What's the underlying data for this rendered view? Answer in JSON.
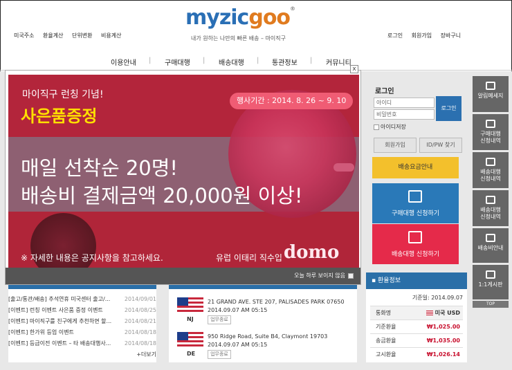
{
  "header": {
    "logo_part1": "myzic",
    "logo_part2": "goo",
    "logo_reg": "®",
    "tagline": "내가 원하는 나만의 빠른 배송 – 마이직구",
    "left_links": [
      "미국주소",
      "환율계산",
      "단위변환",
      "비용계산"
    ],
    "right_links": [
      "로그인",
      "회원가입",
      "장바구니"
    ]
  },
  "nav": {
    "items": [
      "이용안내",
      "구매대행",
      "배송대행",
      "통관정보",
      "커뮤니티"
    ]
  },
  "popup": {
    "close": "x",
    "line1": "마이직구 런칭 기념!",
    "line2": "사은품증정",
    "period": "행사기간 : 2014. 8. 26 ~ 9. 10",
    "big1": "매일 선착순 20명!",
    "big2": "배송비 결제금액 20,000원 이상!",
    "note": "※ 자세한 내용은 공지사항을 참고하세요.",
    "brand_text": "유럽 이태리 직수입",
    "brand_logo": "domo",
    "footer_text": "오늘 하루 보이지 않음"
  },
  "login": {
    "title": "로그인",
    "id_placeholder": "아이디",
    "pw_placeholder": "비밀번호",
    "login_button": "로그인",
    "save_id": "아이디저장",
    "join": "회원가입",
    "find": "ID/PW 찾기",
    "shipping_fee": "배송요금안내",
    "buy_request": "구매대행 신청하기",
    "ship_request": "배송대행 신청하기"
  },
  "quickbar": {
    "items": [
      "알림메세지",
      "구매대행\n신청내역",
      "배송대행\n신청내역",
      "배송대행\n신청내역",
      "배송비안내",
      "1:1게시판"
    ],
    "top": "TOP"
  },
  "news": {
    "items": [
      {
        "title": "[출고/통관/배송] 추석연휴 미국센터 출고/...",
        "date": "2014/09/01"
      },
      {
        "title": "[이벤트] 런칭 이벤트 사은품 증정 이벤트",
        "date": "2014/08/25"
      },
      {
        "title": "[이벤트] 마이직구를 친구에게 추천하면 할...",
        "date": "2014/08/21"
      },
      {
        "title": "[이벤트] 한가위 등업 이벤트",
        "date": "2014/08/18"
      },
      {
        "title": "[이벤트] 등급이전 이벤트 – 타 배송대행사...",
        "date": "2014/08/18"
      }
    ],
    "more": "+더보기"
  },
  "shipments": [
    {
      "state": "NJ",
      "address": "21 GRAND AVE. STE 207, PALISADES PARK 07650",
      "time": "2014.09.07 AM 05:15",
      "status": "업무종료"
    },
    {
      "state": "DE",
      "address": "950 Ridge Road, Suite B4, Claymont 19703",
      "time": "2014.09.07 AM 05:15",
      "status": "업무종료"
    }
  ],
  "exchange": {
    "title": "환율정보",
    "base_date": "기준일: 2014.09.07",
    "currency_label": "통화명",
    "currency_value": "미국 USD",
    "rows": [
      {
        "label": "기준환율",
        "value": "₩1,025.00"
      },
      {
        "label": "송금환율",
        "value": "₩1,035.00"
      },
      {
        "label": "고시환율",
        "value": "₩1,026.14"
      }
    ]
  },
  "colors": {
    "brand_blue": "#2a6fb5",
    "brand_orange": "#e07b1f",
    "banner_red": "#b3253b",
    "accent_yellow": "#f3c02c",
    "accent_red": "#e52a4a"
  }
}
